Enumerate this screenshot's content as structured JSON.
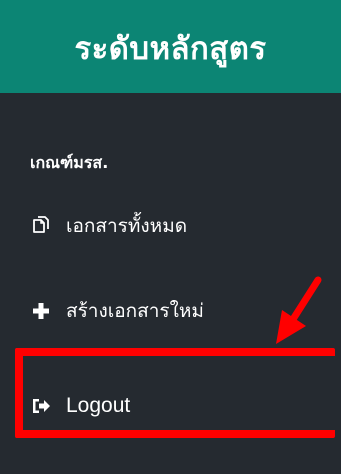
{
  "header": {
    "title": "ระดับหลักสูตร"
  },
  "sidebar": {
    "section_label": "เกณฑ์มรส.",
    "items": [
      {
        "label": "เอกสารทั้งหมด",
        "icon": "copy-icon"
      },
      {
        "label": "สร้างเอกสารใหม่",
        "icon": "plus-icon"
      },
      {
        "label": "Logout",
        "icon": "sign-out-icon"
      }
    ]
  },
  "annotation": {
    "color": "#ff0000",
    "target": "Logout"
  },
  "colors": {
    "header_bg": "#0c8574",
    "sidebar_bg": "#252a30",
    "text": "#ffffff",
    "annotation": "#ff0000"
  }
}
